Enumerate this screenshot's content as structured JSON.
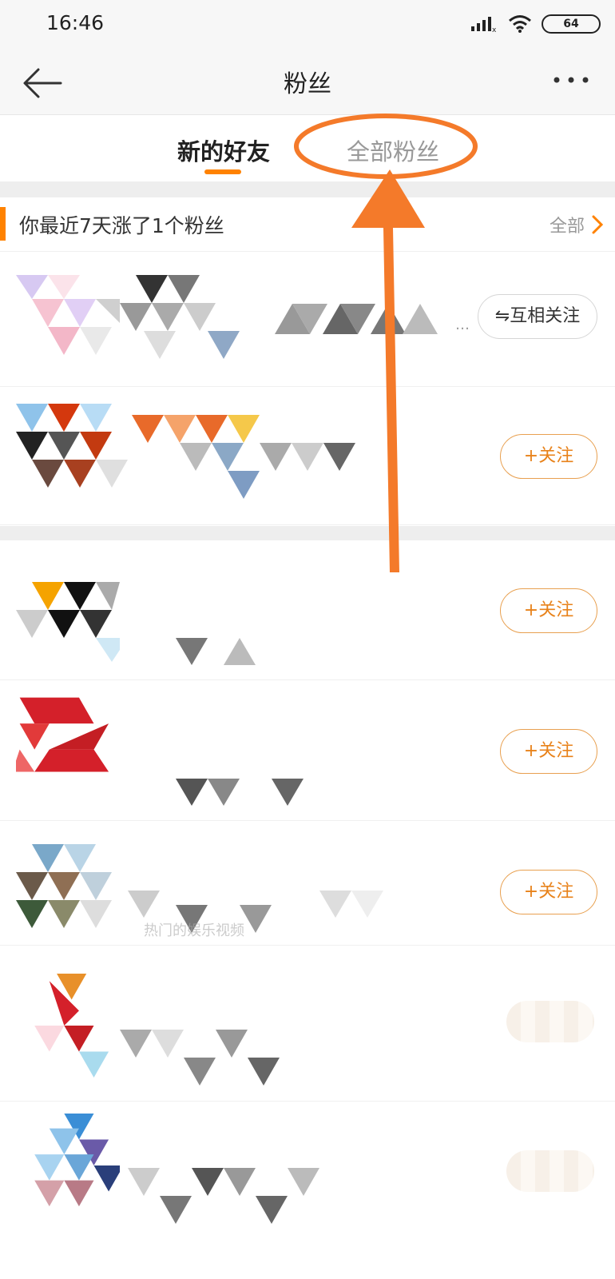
{
  "status_bar": {
    "time": "16:46",
    "battery": "64"
  },
  "nav": {
    "title": "粉丝"
  },
  "tabs": [
    {
      "label": "新的好友",
      "active": true
    },
    {
      "label": "全部粉丝",
      "active": false
    }
  ],
  "section": {
    "title": "你最近7天涨了1个粉丝",
    "more": "全部"
  },
  "buttons": {
    "mutual": "⇋互相关注",
    "follow": "+关注"
  },
  "row_ellipsis": "…",
  "row_hint": "热门的娱乐视频",
  "colors": {
    "accent": "#ff8200",
    "follow_text": "#e8821a",
    "annotation": "#f47a2a"
  }
}
